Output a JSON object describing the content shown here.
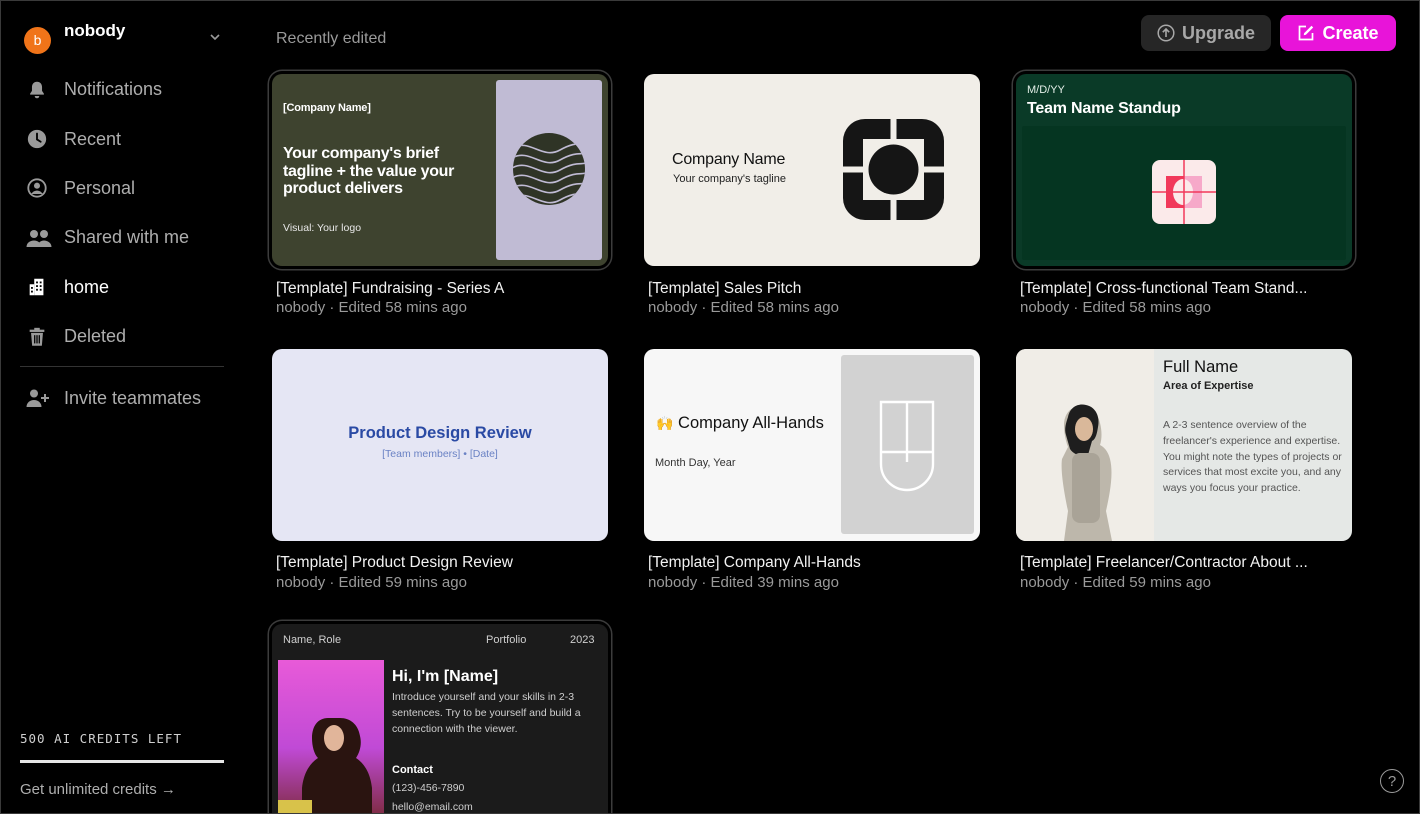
{
  "workspace": {
    "avatar_letter": "b",
    "name": "nobody"
  },
  "nav": [
    {
      "label": "Notifications",
      "icon": "bell-icon",
      "active": false
    },
    {
      "label": "Recent",
      "icon": "clock-icon",
      "active": false
    },
    {
      "label": "Personal",
      "icon": "person-circle-icon",
      "active": false
    },
    {
      "label": "Shared with me",
      "icon": "people-icon",
      "active": false
    },
    {
      "label": "home",
      "icon": "building-icon",
      "active": true
    },
    {
      "label": "Deleted",
      "icon": "trash-icon",
      "active": false
    }
  ],
  "invite_label": "Invite teammates",
  "credits": {
    "label": "500 AI CREDITS LEFT",
    "link": "Get unlimited credits →"
  },
  "header": {
    "section_label": "Recently edited",
    "upgrade_label": "Upgrade",
    "create_label": "Create"
  },
  "colors": {
    "accent": "#e814d9",
    "avatar": "#f07419"
  },
  "cards": [
    {
      "title": "[Template] Fundraising - Series A",
      "meta": "nobody · Edited 58 mins ago",
      "thumb": {
        "company": "[Company Name]",
        "tagline": "Your company's brief tagline + the value your product delivers",
        "visual": "Visual: Your logo"
      }
    },
    {
      "title": "[Template] Sales Pitch",
      "meta": "nobody · Edited 58 mins ago",
      "thumb": {
        "company": "Company Name",
        "tagline": "Your company's tagline"
      }
    },
    {
      "title": "[Template] Cross-functional Team Stand...",
      "meta": "nobody · Edited 58 mins ago",
      "thumb": {
        "date": "M/D/YY",
        "heading": "Team Name Standup"
      }
    },
    {
      "title": "[Template] Product Design Review",
      "meta": "nobody · Edited 59 mins ago",
      "thumb": {
        "heading": "Product Design Review",
        "sub": "[Team members] • [Date]"
      }
    },
    {
      "title": "[Template] Company All-Hands",
      "meta": "nobody · Edited 39 mins ago",
      "thumb": {
        "emoji": "🙌",
        "heading": "Company All-Hands",
        "date": "Month Day, Year"
      }
    },
    {
      "title": "[Template] Freelancer/Contractor About ...",
      "meta": "nobody · Edited 59 mins ago",
      "thumb": {
        "name": "Full Name",
        "area": "Area of Expertise",
        "body": "A 2-3 sentence overview of the freelancer's experience and expertise. You might note the types of projects or services that most excite you, and any ways you focus your practice."
      }
    },
    {
      "thumb": {
        "name_role": "Name, Role",
        "portfolio": "Portfolio",
        "year": "2023",
        "greeting": "Hi, I'm [Name]",
        "intro": "Introduce yourself and your skills in 2-3 sentences. Try to be yourself and build a connection with the viewer.",
        "contact": "Contact",
        "phone": "(123)-456-7890",
        "email": "hello@email.com"
      }
    }
  ],
  "help_label": "?"
}
